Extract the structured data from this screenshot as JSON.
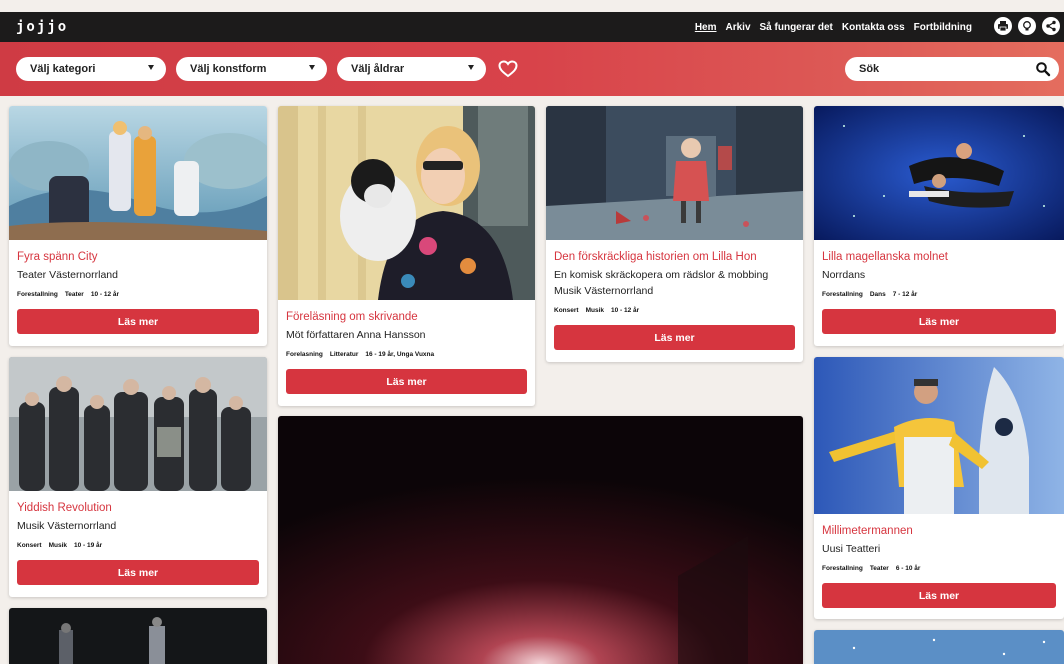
{
  "app": {
    "logo": "jojjo"
  },
  "nav": {
    "items": [
      {
        "label": "Hem",
        "active": true
      },
      {
        "label": "Arkiv",
        "active": false
      },
      {
        "label": "Så fungerar det",
        "active": false
      },
      {
        "label": "Kontakta oss",
        "active": false
      },
      {
        "label": "Fortbildning",
        "active": false
      }
    ],
    "icons": [
      "print-icon",
      "lightbulb-icon",
      "share-icon"
    ]
  },
  "filters": {
    "category": "Välj kategori",
    "artform": "Välj konstform",
    "ages": "Välj åldrar",
    "search_placeholder": "Sök"
  },
  "cards": [
    {
      "title": "Fyra spänn City",
      "subtitle": "Teater Västernorrland",
      "tags": [
        "Forestallning",
        "Teater",
        "10 - 12 år"
      ],
      "button": "Läs mer"
    },
    {
      "title": "Föreläsning om skrivande",
      "subtitle": "Möt författaren Anna Hansson",
      "tags": [
        "Forelasning",
        "Litteratur",
        "16 - 19 år, Unga Vuxna"
      ],
      "button": "Läs mer"
    },
    {
      "title": "Den förskräckliga historien om Lilla Hon",
      "subtitle": "En komisk skräckopera om rädslor & mobbing",
      "subtitle2": "Musik Västernorrland",
      "tags": [
        "Konsert",
        "Musik",
        "10 - 12 år"
      ],
      "button": "Läs mer"
    },
    {
      "title": "Lilla magellanska molnet",
      "subtitle": "Norrdans",
      "tags": [
        "Forestallning",
        "Dans",
        "7 - 12 år"
      ],
      "button": "Läs mer"
    },
    {
      "title": "Yiddish Revolution",
      "subtitle": "Musik Västernorrland",
      "tags": [
        "Konsert",
        "Musik",
        "10 - 19 år"
      ],
      "button": "Läs mer"
    },
    {
      "title": "Millimetermannen",
      "subtitle": "Uusi Teatteri",
      "tags": [
        "Forestallning",
        "Teater",
        "6 - 10 år"
      ],
      "button": "Läs mer"
    }
  ],
  "colors": {
    "brand_red": "#d6353f",
    "topbar": "#1c1b1b",
    "page_bg": "#f3efeb"
  }
}
